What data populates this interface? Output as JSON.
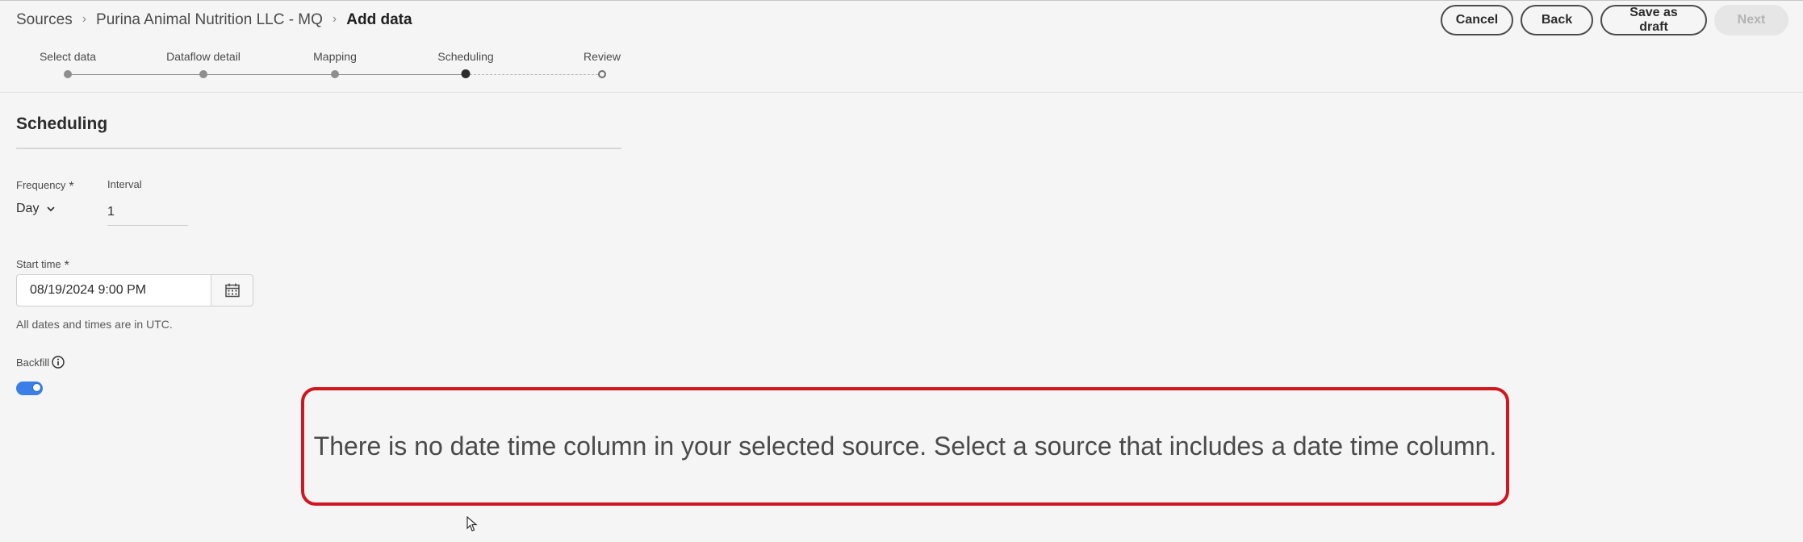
{
  "breadcrumb": {
    "items": [
      "Sources",
      "Purina Animal Nutrition LLC - MQ"
    ],
    "current": "Add data",
    "separator": "›"
  },
  "actions": {
    "cancel": "Cancel",
    "back": "Back",
    "save_draft": "Save as draft",
    "next": "Next"
  },
  "stepper": {
    "steps": [
      "Select data",
      "Dataflow detail",
      "Mapping",
      "Scheduling",
      "Review"
    ],
    "current_step": "Scheduling"
  },
  "section": {
    "title": "Scheduling"
  },
  "frequency": {
    "label": "Frequency",
    "required_marker": "*",
    "value": "Day"
  },
  "interval": {
    "label": "Interval",
    "value": "1"
  },
  "start_time": {
    "label": "Start time",
    "required_marker": "*",
    "value": "08/19/2024 9:00 PM",
    "help": "All dates and times are in UTC."
  },
  "backfill": {
    "label": "Backfill",
    "enabled": true
  },
  "callout": {
    "text": "There is no date time column in your selected source. Select a source that includes a date time column."
  },
  "colors": {
    "toggle_on": "#3b7ee8",
    "callout_border": "#d0161e",
    "background": "#f5f5f5"
  },
  "icons": {
    "breadcrumb_separator": "chevron-right-icon",
    "frequency_dropdown": "chevron-down-icon",
    "date_picker": "calendar-icon",
    "backfill_info": "info-icon",
    "pointer": "cursor-icon"
  }
}
